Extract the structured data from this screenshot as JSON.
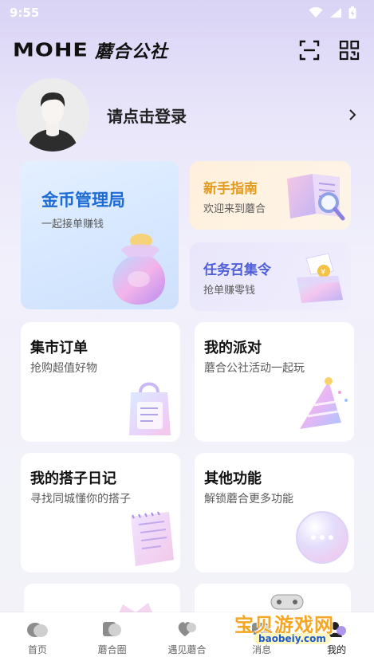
{
  "status": {
    "time": "9:55"
  },
  "header": {
    "logo_en": "MOHE",
    "logo_cn": "蘑合公社"
  },
  "profile": {
    "login_text": "请点击登录"
  },
  "cards": {
    "coin": {
      "title": "金币管理局",
      "subtitle": "一起接单赚钱"
    },
    "guide": {
      "title": "新手指南",
      "subtitle": "欢迎来到蘑合"
    },
    "task": {
      "title": "任务召集令",
      "subtitle": "抢单赚零钱"
    },
    "market": {
      "title": "集市订单",
      "subtitle": "抢购超值好物"
    },
    "party": {
      "title": "我的派对",
      "subtitle": "蘑合公社活动一起玩"
    },
    "diary": {
      "title": "我的搭子日记",
      "subtitle": "寻找同城懂你的搭子"
    },
    "other": {
      "title": "其他功能",
      "subtitle": "解锁蘑合更多功能"
    }
  },
  "tabbar": {
    "items": [
      {
        "label": "首页",
        "icon": "home-icon"
      },
      {
        "label": "蘑合圈",
        "icon": "circle-icon"
      },
      {
        "label": "遇见蘑合",
        "icon": "heart-icon"
      },
      {
        "label": "消息",
        "icon": "message-icon"
      },
      {
        "label": "我的",
        "icon": "profile-icon"
      }
    ],
    "active_index": 4
  },
  "watermark": {
    "title": "宝贝游戏网",
    "url": "baobeiy.com"
  },
  "colors": {
    "coin_title": "#1e6bd6",
    "guide_title": "#e39a1e",
    "task_title": "#4f5fd8"
  }
}
